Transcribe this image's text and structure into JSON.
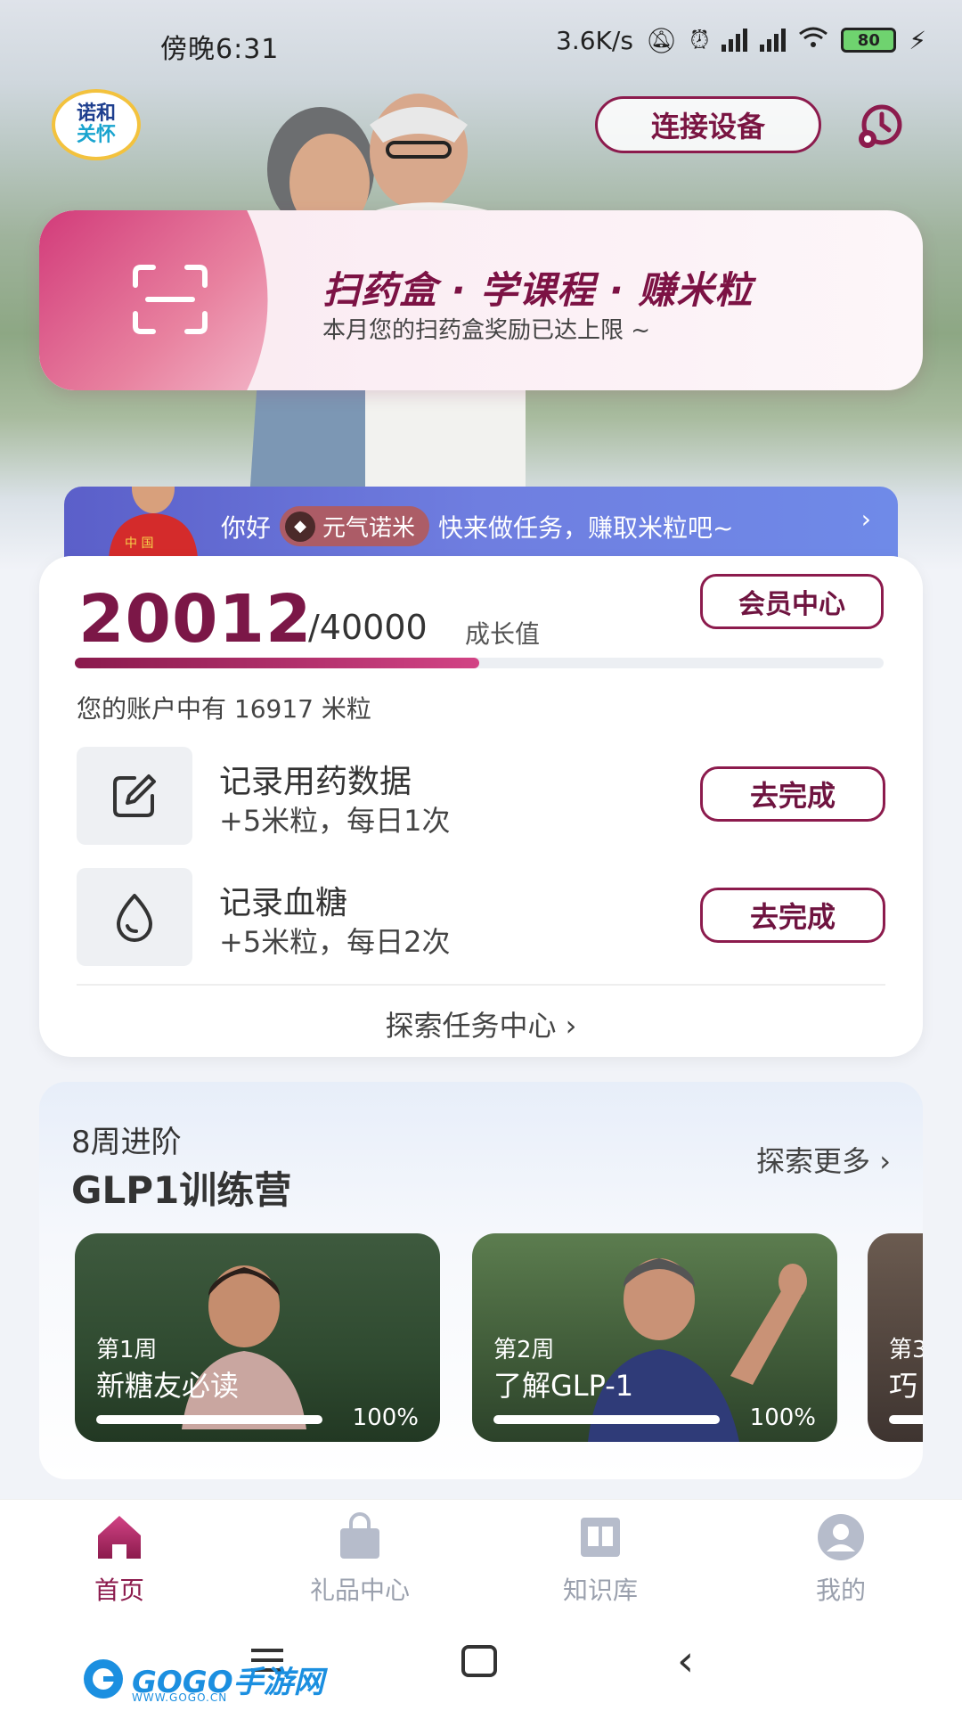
{
  "status_bar": {
    "time": "傍晚6:31",
    "speed": "3.6K/s",
    "battery": "80"
  },
  "header": {
    "logo_line1": "诺和",
    "logo_line2": "关怀",
    "connect_label": "连接设备"
  },
  "scan_banner": {
    "title": "扫药盒 · 学课程 · 赚米粒",
    "subtitle": "本月您的扫药盒奖励已达上限 ~"
  },
  "welcome": {
    "greeting": "你好",
    "nickname": "元气诺米",
    "message": "快来做任务，赚取米粒吧~",
    "chevron": "›"
  },
  "growth": {
    "current": "20012",
    "total": "/40000",
    "unit": "成长值",
    "progress_fraction": 0.5,
    "member_center_label": "会员中心",
    "balance_text": "您的账户中有 16917 米粒"
  },
  "tasks": [
    {
      "title": "记录用药数据",
      "desc": "+5米粒，每日1次",
      "button": "去完成",
      "icon": "edit-icon"
    },
    {
      "title": "记录血糖",
      "desc": "+5米粒，每日2次",
      "button": "去完成",
      "icon": "drop-icon"
    }
  ],
  "explore_tasks_label": "探索任务中心 ›",
  "glp": {
    "subtitle": "8周进阶",
    "title": "GLP1训练营",
    "explore_more": "探索更多 ›",
    "courses": [
      {
        "week": "第1周",
        "name": "新糖友必读",
        "progress": "100%"
      },
      {
        "week": "第2周",
        "name": "了解GLP-1",
        "progress": "100%"
      },
      {
        "week": "第3",
        "name": "巧"
      }
    ]
  },
  "tabbar": {
    "items": [
      {
        "label": "首页",
        "icon": "home-icon",
        "active": true
      },
      {
        "label": "礼品中心",
        "icon": "bag-icon",
        "active": false
      },
      {
        "label": "知识库",
        "icon": "book-icon",
        "active": false
      },
      {
        "label": "我的",
        "icon": "user-icon",
        "active": false
      }
    ]
  },
  "watermark": {
    "text": "GOGO手游网",
    "sub": "WWW.GOGO.CN"
  },
  "colors": {
    "accent": "#8c1b4d",
    "accent_pink": "#d24385",
    "welcome_blue": "#6f7ee0"
  }
}
